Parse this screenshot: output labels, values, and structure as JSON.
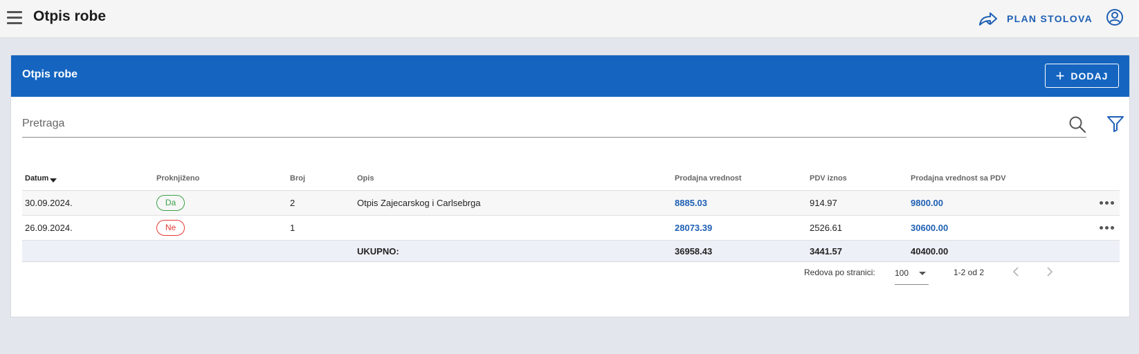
{
  "topbar": {
    "title": "Otpis robe",
    "plan_link": "PLAN STOLOVA",
    "icons": {
      "menu": "hamburger-icon",
      "plan": "share-arrow-icon",
      "account": "account-circle-icon"
    }
  },
  "card": {
    "title": "Otpis robe",
    "add_label": "DODAJ",
    "search_placeholder": "Pretraga"
  },
  "table": {
    "columns": [
      "Datum",
      "Proknjiženo",
      "Broj",
      "Opis",
      "Prodajna vrednost",
      "PDV iznos",
      "Prodajna vrednost sa PDV"
    ],
    "rows": [
      {
        "date": "30.09.2024.",
        "posted": "Da",
        "number": "2",
        "description": "Otpis Zajecarskog i Carlsebrga",
        "sale_value": "8885.03",
        "vat": "914.97",
        "sale_value_vat": "9800.00"
      },
      {
        "date": "26.09.2024.",
        "posted": "Ne",
        "number": "1",
        "description": "",
        "sale_value": "28073.39",
        "vat": "2526.61",
        "sale_value_vat": "30600.00"
      }
    ],
    "total": {
      "label": "UKUPNO:",
      "sale_value": "36958.43",
      "vat": "3441.57",
      "sale_value_vat": "40400.00"
    }
  },
  "pagination": {
    "rows_per_page_label": "Redova po stranici:",
    "rows_per_page": "100",
    "range": "1-2 od 2"
  },
  "colors": {
    "primary": "#1565c0",
    "link": "#1e5fb4",
    "posted_yes": "#3aa047",
    "posted_no": "#e53935"
  }
}
